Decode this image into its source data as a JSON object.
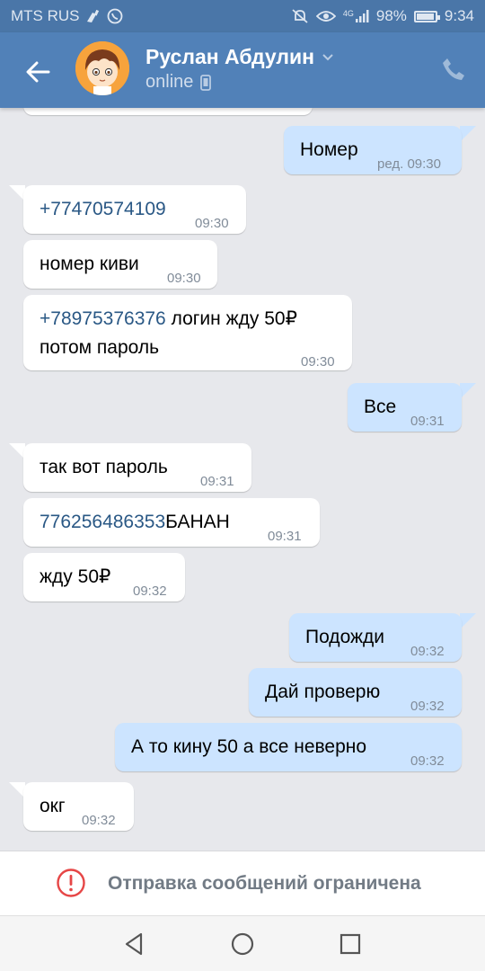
{
  "status_bar": {
    "carrier": "MTS RUS",
    "network": "4G",
    "battery": "98%",
    "time": "9:34"
  },
  "header": {
    "contact_name": "Руслан Абдулин",
    "status": "online"
  },
  "messages": [
    {
      "dir": "out",
      "text": "Номер",
      "time": "ред. 09:30"
    },
    {
      "dir": "in",
      "link": "+77470574109",
      "text": "",
      "time": "09:30"
    },
    {
      "dir": "in",
      "text": "номер киви",
      "time": "09:30"
    },
    {
      "dir": "in",
      "link": "+78975376376",
      "text": " логин жду 50₽",
      "line2": "потом пароль",
      "time": "09:30"
    },
    {
      "dir": "out",
      "text": "Все",
      "time": "09:31"
    },
    {
      "dir": "in",
      "text": "так вот пароль",
      "time": "09:31"
    },
    {
      "dir": "in",
      "link": "776256486353",
      "text": "БАНАН",
      "time": "09:31"
    },
    {
      "dir": "in",
      "text": "жду 50₽",
      "time": "09:32"
    },
    {
      "dir": "out",
      "text": "Подожди",
      "time": "09:32"
    },
    {
      "dir": "out",
      "text": "Дай проверю",
      "time": "09:32"
    },
    {
      "dir": "out",
      "text": "А то кину 50 а все неверно",
      "time": "09:32"
    },
    {
      "dir": "in",
      "text": "окг",
      "time": "09:32"
    }
  ],
  "restriction": {
    "text": "Отправка сообщений ограничена"
  },
  "colors": {
    "header": "#5181b8",
    "status_bar": "#4a76a8",
    "chat_bg": "#e7e8ec",
    "incoming": "#ffffff",
    "outgoing": "#cce4ff",
    "link": "#2a5885",
    "warning": "#e64646"
  }
}
